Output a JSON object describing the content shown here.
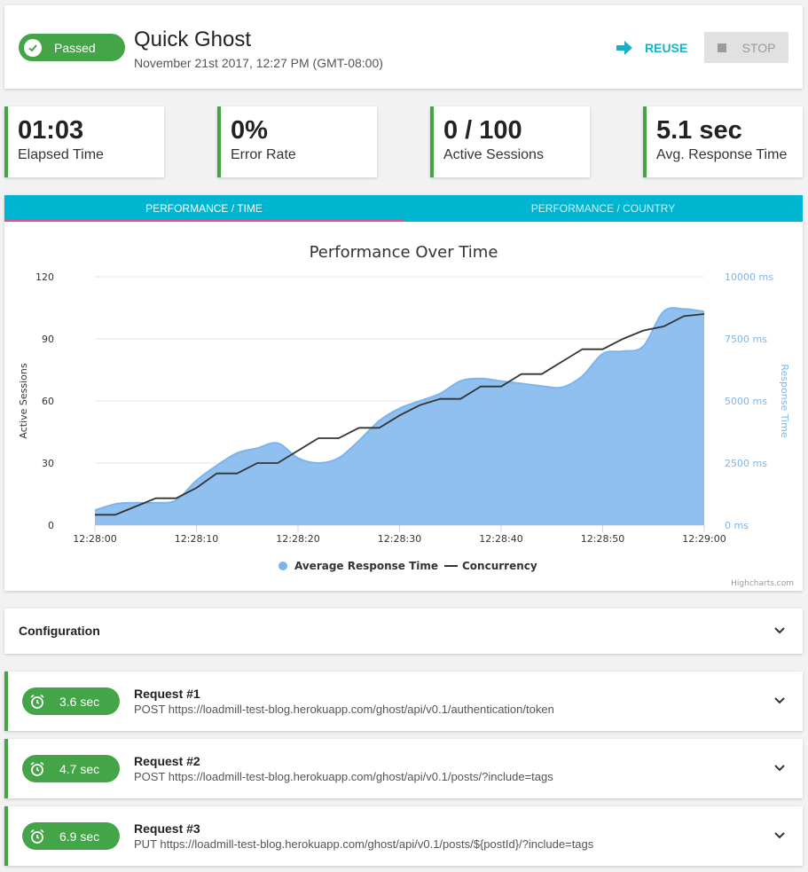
{
  "header": {
    "status": "Passed",
    "title": "Quick Ghost",
    "date": "November 21st 2017, 12:27 PM (GMT-08:00)",
    "reuse_label": "REUSE",
    "stop_label": "STOP"
  },
  "stats": [
    {
      "value": "01:03",
      "label": "Elapsed Time"
    },
    {
      "value": "0%",
      "label": "Error Rate"
    },
    {
      "value": "0 / 100",
      "label": "Active Sessions"
    },
    {
      "value": "5.1 sec",
      "label": "Avg. Response Time"
    }
  ],
  "tabs": [
    {
      "label": "PERFORMANCE / TIME",
      "active": true
    },
    {
      "label": "PERFORMANCE / COUNTRY",
      "active": false
    }
  ],
  "chart_data": {
    "type": "area",
    "title": "Performance Over Time",
    "x": [
      "12:28:00",
      "12:28:02",
      "12:28:04",
      "12:28:06",
      "12:28:08",
      "12:28:10",
      "12:28:12",
      "12:28:14",
      "12:28:16",
      "12:28:18",
      "12:28:20",
      "12:28:22",
      "12:28:24",
      "12:28:26",
      "12:28:28",
      "12:28:30",
      "12:28:32",
      "12:28:34",
      "12:28:36",
      "12:28:38",
      "12:28:40",
      "12:28:42",
      "12:28:44",
      "12:28:46",
      "12:28:48",
      "12:28:50",
      "12:28:52",
      "12:28:54",
      "12:28:56",
      "12:28:58",
      "12:29:00"
    ],
    "xtick_labels": [
      "12:28:00",
      "12:28:10",
      "12:28:20",
      "12:28:30",
      "12:28:40",
      "12:28:50",
      "12:29:00"
    ],
    "y_left": {
      "label": "Active Sessions",
      "range": [
        0,
        120
      ],
      "ticks": [
        "0",
        "30",
        "60",
        "90",
        "120"
      ]
    },
    "y_right": {
      "label": "Response Time",
      "range": [
        0,
        10000
      ],
      "ticks": [
        "0 ms",
        "2500 ms",
        "5000 ms",
        "7500 ms",
        "10000 ms"
      ]
    },
    "series": [
      {
        "name": "Average Response Time",
        "axis": "right",
        "color": "#7cb5ec",
        "values": [
          600,
          850,
          900,
          900,
          1000,
          1800,
          2400,
          2900,
          3100,
          3300,
          2700,
          2500,
          2700,
          3400,
          4200,
          4700,
          5000,
          5300,
          5800,
          5900,
          5800,
          5700,
          5600,
          5550,
          6000,
          6900,
          7000,
          7200,
          8600,
          8700,
          8600
        ]
      },
      {
        "name": "Concurrency",
        "axis": "left",
        "color": "#333333",
        "values": [
          5,
          5,
          9,
          13,
          13,
          18,
          25,
          25,
          30,
          30,
          36,
          42,
          42,
          47,
          47,
          53,
          58,
          61,
          61,
          67,
          67,
          73,
          73,
          79,
          85,
          85,
          90,
          94,
          96,
          101,
          102
        ]
      }
    ],
    "legend_position": "bottom-center",
    "credit": "Highcharts.com"
  },
  "config": {
    "label": "Configuration"
  },
  "requests": [
    {
      "time": "3.6 sec",
      "title": "Request #1",
      "url": "POST https://loadmill-test-blog.herokuapp.com/ghost/api/v0.1/authentication/token"
    },
    {
      "time": "4.7 sec",
      "title": "Request #2",
      "url": "POST https://loadmill-test-blog.herokuapp.com/ghost/api/v0.1/posts/?include=tags"
    },
    {
      "time": "6.9 sec",
      "title": "Request #3",
      "url": "PUT https://loadmill-test-blog.herokuapp.com/ghost/api/v0.1/posts/${postId}/?include=tags"
    }
  ],
  "colors": {
    "success": "#43a547",
    "accent": "#00b5cf",
    "tab_indicator": "#ff4081"
  }
}
